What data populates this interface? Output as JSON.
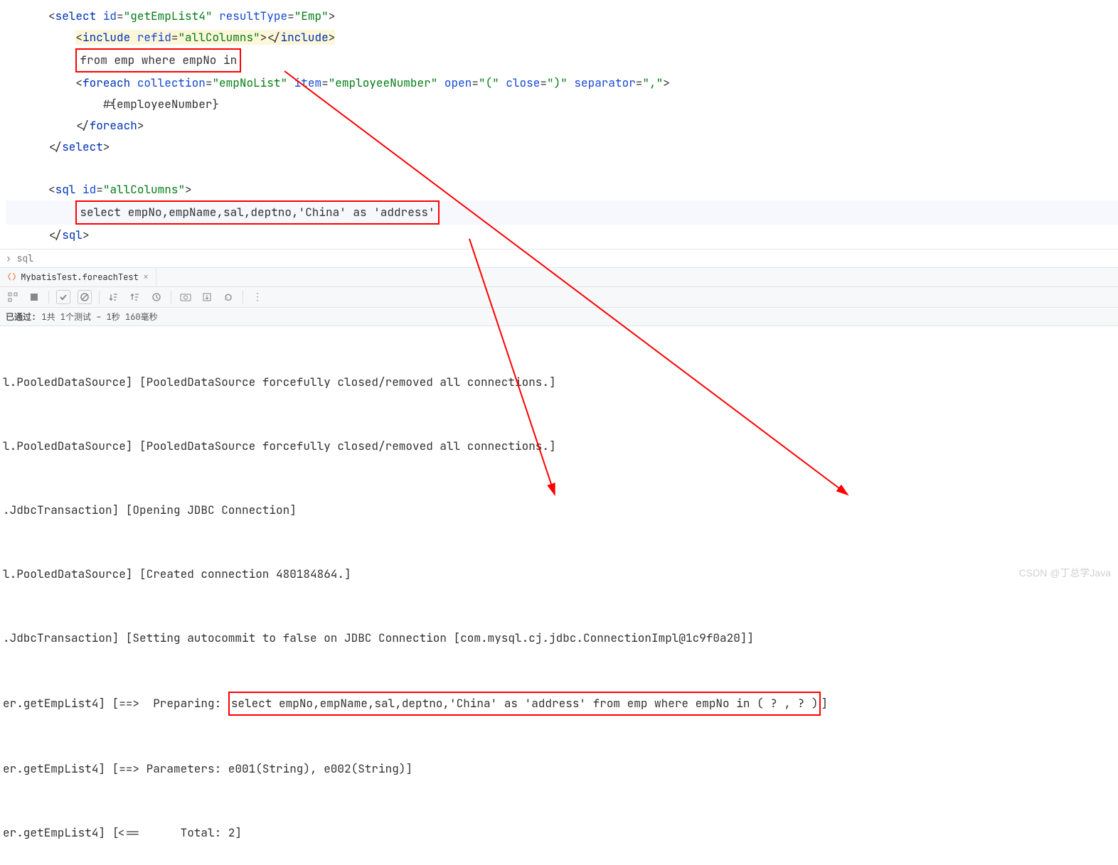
{
  "editor": {
    "select_open": {
      "tag": "select",
      "id_attr": "id",
      "id_val": "\"getEmpList4\"",
      "rt_attr": "resultType",
      "rt_val": "\"Emp\""
    },
    "include": {
      "tag": "include",
      "refid_attr": "refid",
      "refid_val": "\"allColumns\"",
      "close": "include"
    },
    "from_text": "from emp where empNo in",
    "foreach": {
      "tag": "foreach",
      "coll_attr": "collection",
      "coll_val": "\"empNoList\"",
      "item_attr": "item",
      "item_val": "\"employeeNumber\"",
      "open_attr": "open",
      "open_val": "\"(\"",
      "close_attr": "close",
      "close_val": "\")\"",
      "sep_attr": "separator",
      "sep_val": "\",\""
    },
    "param_text": "#{employeeNumber}",
    "foreach_close": "foreach",
    "select_close": "select",
    "sql_open": {
      "tag": "sql",
      "id_attr": "id",
      "id_val": "\"allColumns\""
    },
    "sql_text": "select empNo,empName,sal,deptno,'China' as 'address'",
    "sql_close": "sql"
  },
  "breadcrumb": {
    "chevron": "›",
    "item": "sql"
  },
  "tab": {
    "label": "MybatisTest.foreachTest"
  },
  "toolbar": {
    "icons": [
      "settings",
      "stop",
      "check",
      "nosign",
      "step-down",
      "step-up",
      "clock",
      "camera",
      "export",
      "rerun",
      "more"
    ]
  },
  "status": {
    "text1": "已通过:",
    "val1": "1",
    "text2": "共 1个测试 – 1秒 160毫秒"
  },
  "console": {
    "lines": [
      "l.PooledDataSource] [PooledDataSource forcefully closed/removed all connections.]",
      "l.PooledDataSource] [PooledDataSource forcefully closed/removed all connections.]",
      ".JdbcTransaction] [Opening JDBC Connection]",
      "l.PooledDataSource] [Created connection 480184864.]",
      ".JdbcTransaction] [Setting autocommit to false on JDBC Connection [com.mysql.cj.jdbc.ConnectionImpl@1c9f0a20]]"
    ],
    "prep_prefix": "er.getEmpList4] [==>  Preparing: ",
    "prep_sql": "select empNo,empName,sal,deptno,'China' as 'address' from emp where empNo in ( ? , ? )",
    "prep_suffix": "]",
    "params": "er.getEmpList4] [==> Parameters: e001(String), e002(String)]",
    "total": "er.getEmpList4] [<==      Total: 2]"
  },
  "watermark": "CSDN @丁总学Java"
}
